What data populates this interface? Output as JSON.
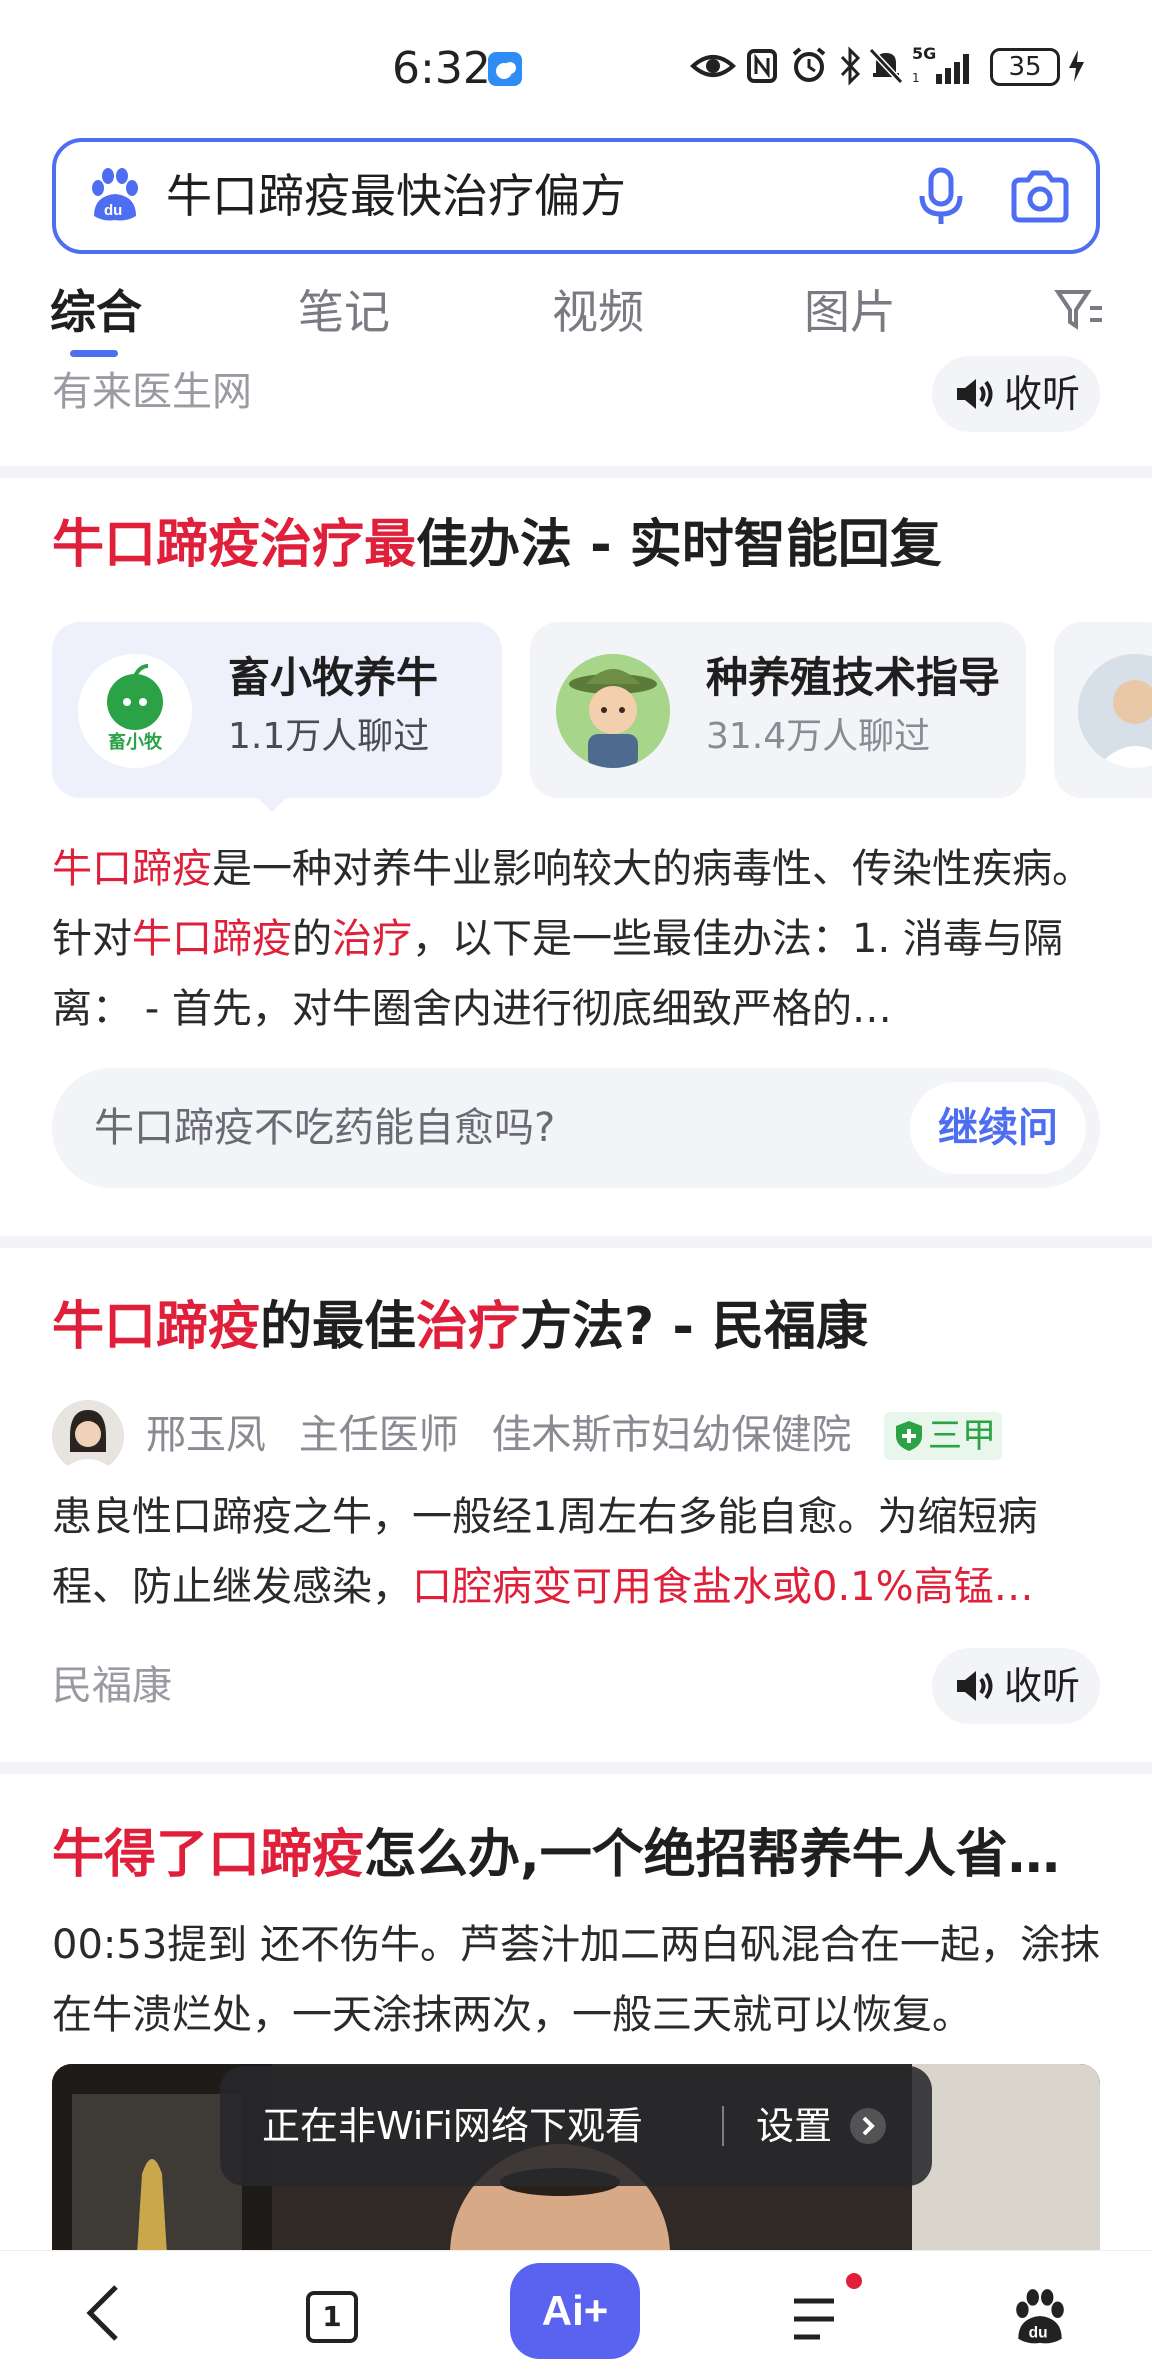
{
  "status_bar": {
    "time": "6:32",
    "network": "5G",
    "battery": "35"
  },
  "search": {
    "query": "牛口蹄疫最快治疗偏方"
  },
  "tabs": [
    {
      "label": "综合",
      "active": true
    },
    {
      "label": "笔记"
    },
    {
      "label": "视频"
    },
    {
      "label": "图片"
    }
  ],
  "top_source": {
    "source": "有来医生网",
    "listen_label": "收听"
  },
  "ai_card": {
    "title_highlight": "牛口蹄疫治疗最",
    "title_rest": "佳办法 - 实时智能回复",
    "agents": [
      {
        "name": "畜小牧养牛",
        "count": "1.1万人聊过",
        "logo_text": "畜小牧"
      },
      {
        "name": "种养殖技术指导",
        "count": "31.4万人聊过"
      }
    ],
    "answer_parts": [
      {
        "text": "牛口蹄疫",
        "hl": true
      },
      {
        "text": "是一种对养牛业影响较大的病毒性、传染性疾病。针对",
        "hl": false
      },
      {
        "text": "牛口蹄疫",
        "hl": true
      },
      {
        "text": "的",
        "hl": false
      },
      {
        "text": "治疗",
        "hl": true
      },
      {
        "text": "，以下是一些最佳办法：1. 消毒与隔离： - 首先，对牛圈舍内进行彻底细致严格的…",
        "hl": false
      }
    ],
    "followup_question": "牛口蹄疫不吃药能自愈吗?",
    "followup_button": "继续问"
  },
  "result_2": {
    "title_parts": [
      {
        "text": "牛口蹄疫",
        "hl": true
      },
      {
        "text": "的最佳",
        "hl": false
      },
      {
        "text": "治疗",
        "hl": true
      },
      {
        "text": "方法? - 民福康",
        "hl": false
      }
    ],
    "author": "邢玉凤",
    "author_title": "主任医师",
    "hospital": "佳木斯市妇幼保健院",
    "badge": "三甲",
    "snippet_plain": "患良性口蹄疫之牛，一般经1周左右多能自愈。为缩短病程、防止继发感染，",
    "snippet_hl": "口腔病变可用食盐水或0.1%高锰…",
    "source": "民福康",
    "listen_label": "收听"
  },
  "result_3": {
    "title_hl": "牛得了口蹄疫",
    "title_rest": "怎么办,一个绝招帮养牛人省…",
    "snippet": "00:53提到 还不伤牛。芦荟汁加二两白矾混合在一起，涂抹在牛溃烂处，一天涂抹两次，一般三天就可以恢复。",
    "video_toast": "正在非WiFi网络下观看",
    "video_toast_action": "设置"
  },
  "bottom_nav": {
    "tab_count": "1",
    "ai_label": "Ai+"
  },
  "colors": {
    "accent": "#4e6ef2",
    "highlight": "#e0203a",
    "badge_green": "#2ba245"
  }
}
